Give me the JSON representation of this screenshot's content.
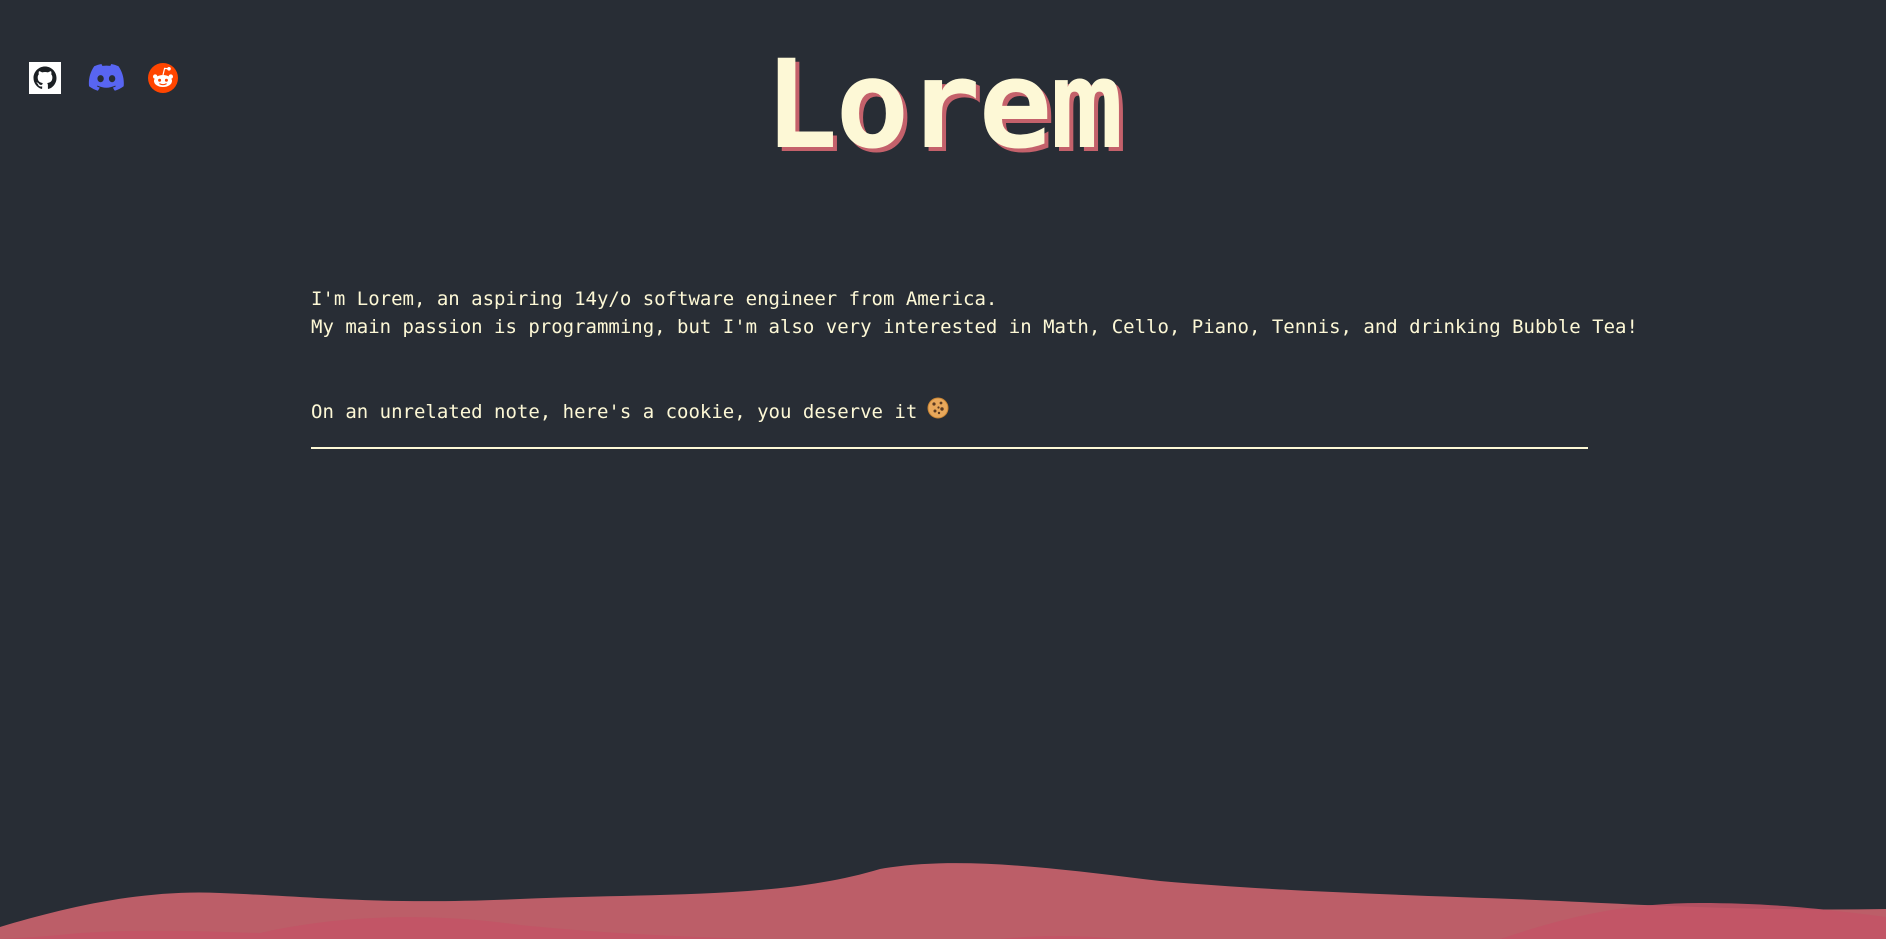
{
  "social": {
    "github_icon": "github-icon",
    "discord_icon": "discord-icon",
    "reddit_icon": "reddit-icon",
    "colors": {
      "github": "#ffffff",
      "discord": "#5865f2",
      "reddit": "#ff4500"
    }
  },
  "header": {
    "title": "Lorem"
  },
  "intro": {
    "line1": "I'm Lorem, an aspiring 14y/o software engineer from America.",
    "line2": "My main passion is programming, but I'm also very interested in Math, Cello, Piano, Tennis, and drinking Bubble Tea!",
    "cookie_text": "On an unrelated note, here's a cookie, you deserve it",
    "cookie_icon": "cookie-icon"
  },
  "theme": {
    "background": "#282d35",
    "text": "#fdf8d6",
    "accent": "#c4616b"
  }
}
